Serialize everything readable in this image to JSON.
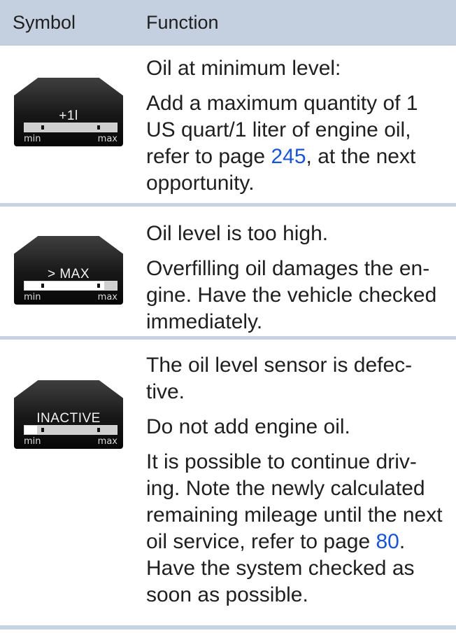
{
  "header": {
    "symbol": "Symbol",
    "function": "Function"
  },
  "rows": [
    {
      "icon": "oil-add-one-liter-display",
      "display_text": "+1l",
      "min_label": "min",
      "max_label": "max",
      "lines": [
        "Oil at minimum level:",
        "Add a maximum quantity of 1 US quart/1 liter of engine oil, refer to page",
        "245",
        ", at the next opportunity."
      ]
    },
    {
      "icon": "oil-over-max-display",
      "display_text": "> MAX",
      "min_label": "min",
      "max_label": "max",
      "lines": [
        "Oil level is too high.",
        "Overfilling oil damages the en-gine. Have the vehicle checked immediately."
      ]
    },
    {
      "icon": "oil-inactive-display",
      "display_text": "INACTIVE",
      "min_label": "min",
      "max_label": "max",
      "lines": [
        "The oil level sensor is defec-tive.",
        "Do not add engine oil.",
        "It is possible to continue driv-ing. Note the newly calculated remaining mileage until the next oil service, refer to page",
        "80",
        ". Have the system checked as soon as possible."
      ]
    }
  ]
}
